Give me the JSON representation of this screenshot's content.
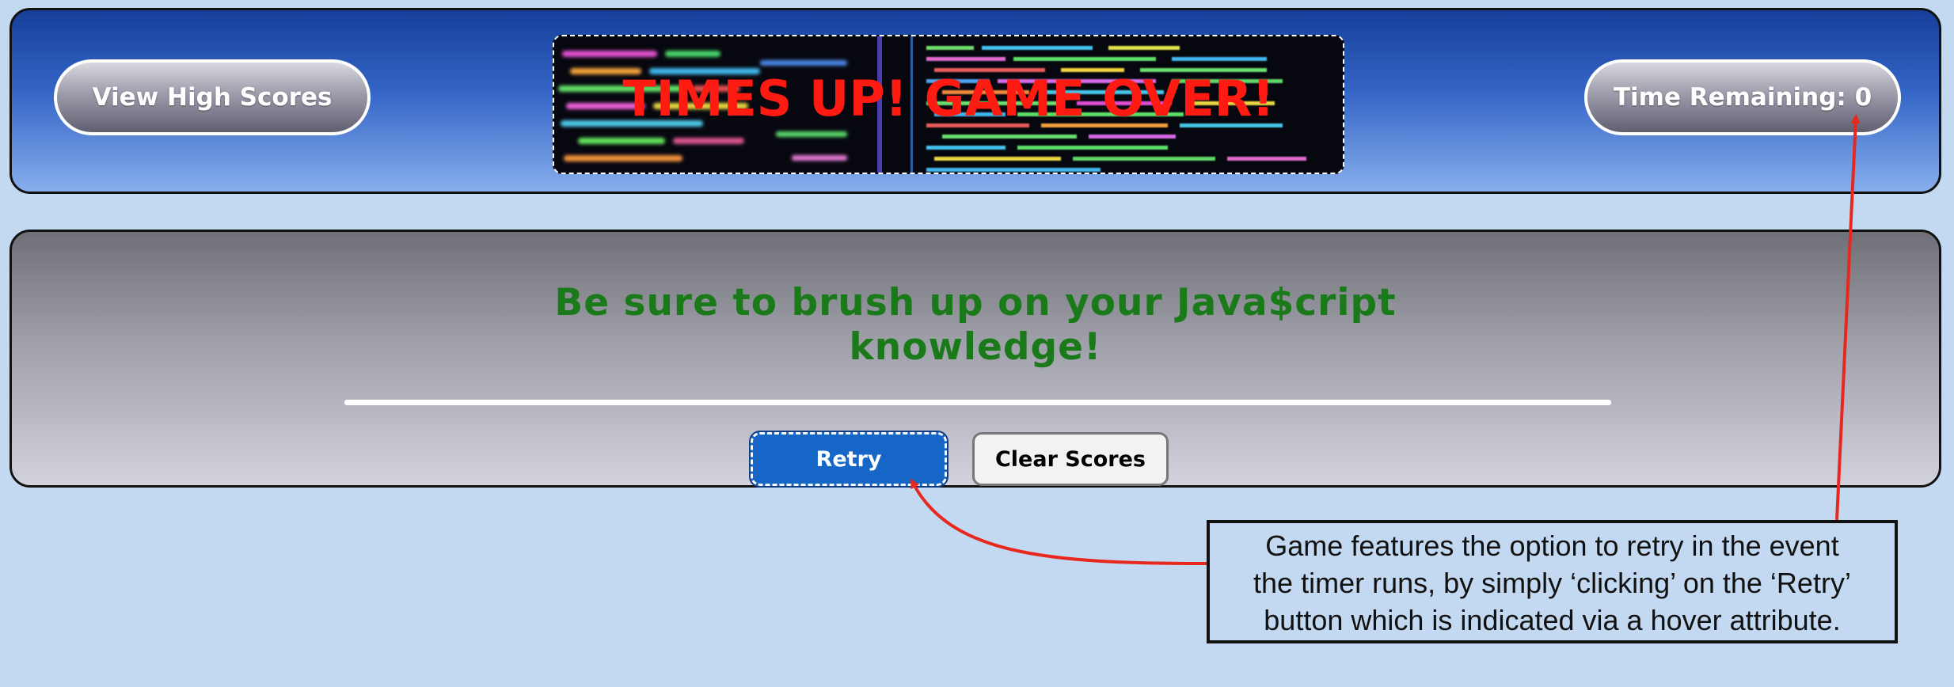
{
  "header": {
    "high_scores_label": "View High Scores",
    "banner_title": "TIMES UP! GAME OVER!",
    "timer_label": "Time Remaining: 0"
  },
  "main": {
    "message_line1": "Be sure to brush up on your Java$cript",
    "message_line2": "knowledge!",
    "retry_label": "Retry",
    "clear_label": "Clear Scores"
  },
  "annotation": {
    "line1": "Game features the option to retry in the event",
    "line2": "the timer runs, by simply ‘clicking’ on the ‘Retry’",
    "line3": "button which is indicated via a hover attribute."
  },
  "colors": {
    "page_background": "#c3d9f1",
    "header_top": "#163f9a",
    "header_bottom": "#87aeec",
    "banner_text": "#ff1a12",
    "message_text": "#1a7a1a",
    "retry_button": "#1566c6",
    "arrow": "#e8281e"
  },
  "icons": {
    "banner_image": "code-screen-image",
    "arrows": "annotation-arrow"
  }
}
